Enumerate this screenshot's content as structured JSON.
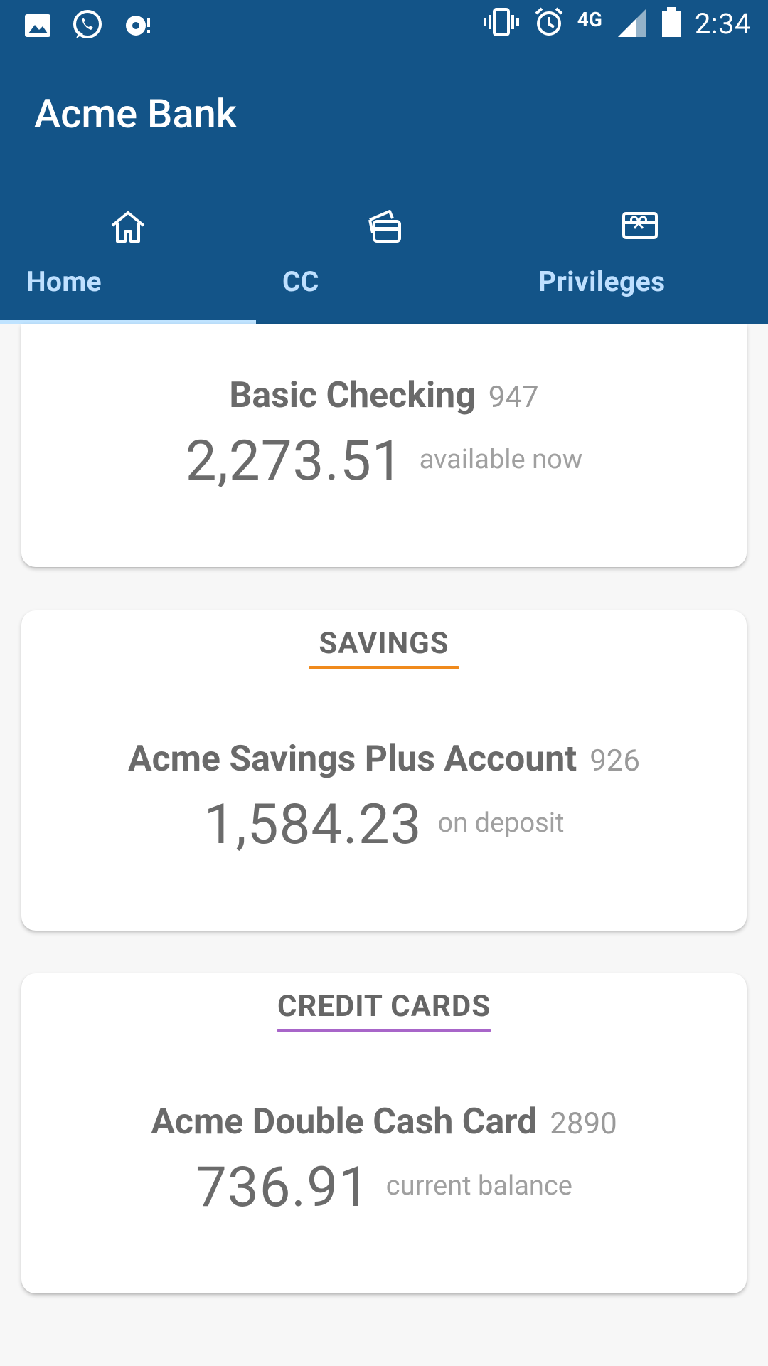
{
  "status_bar": {
    "time": "2:34",
    "network": "4G",
    "icons": [
      "image-icon",
      "whatsapp-icon",
      "sync-icon",
      "vibrate-icon",
      "alarm-icon",
      "signal-icon",
      "battery-icon"
    ]
  },
  "app": {
    "title": "Acme Bank",
    "accent": "#135488"
  },
  "tabs": [
    {
      "label": "Home",
      "icon": "home-icon",
      "selected": true
    },
    {
      "label": "CC",
      "icon": "credit-card-icon",
      "selected": false
    },
    {
      "label": "Privileges",
      "icon": "gift-card-icon",
      "selected": false
    }
  ],
  "accounts": {
    "checking": {
      "name": "Basic Checking",
      "number": "947",
      "amount": "2,273.51",
      "amount_label": "available now"
    },
    "savings": {
      "section_title": "SAVINGS",
      "underline_color": "#f08a1c",
      "name": "Acme Savings Plus Account",
      "number": "926",
      "amount": "1,584.23",
      "amount_label": "on deposit"
    },
    "credit_cards": {
      "section_title": "CREDIT CARDS",
      "underline_color": "#a865c9",
      "name": "Acme Double Cash Card",
      "number": "2890",
      "amount": "736.91",
      "amount_label": "current balance"
    }
  }
}
